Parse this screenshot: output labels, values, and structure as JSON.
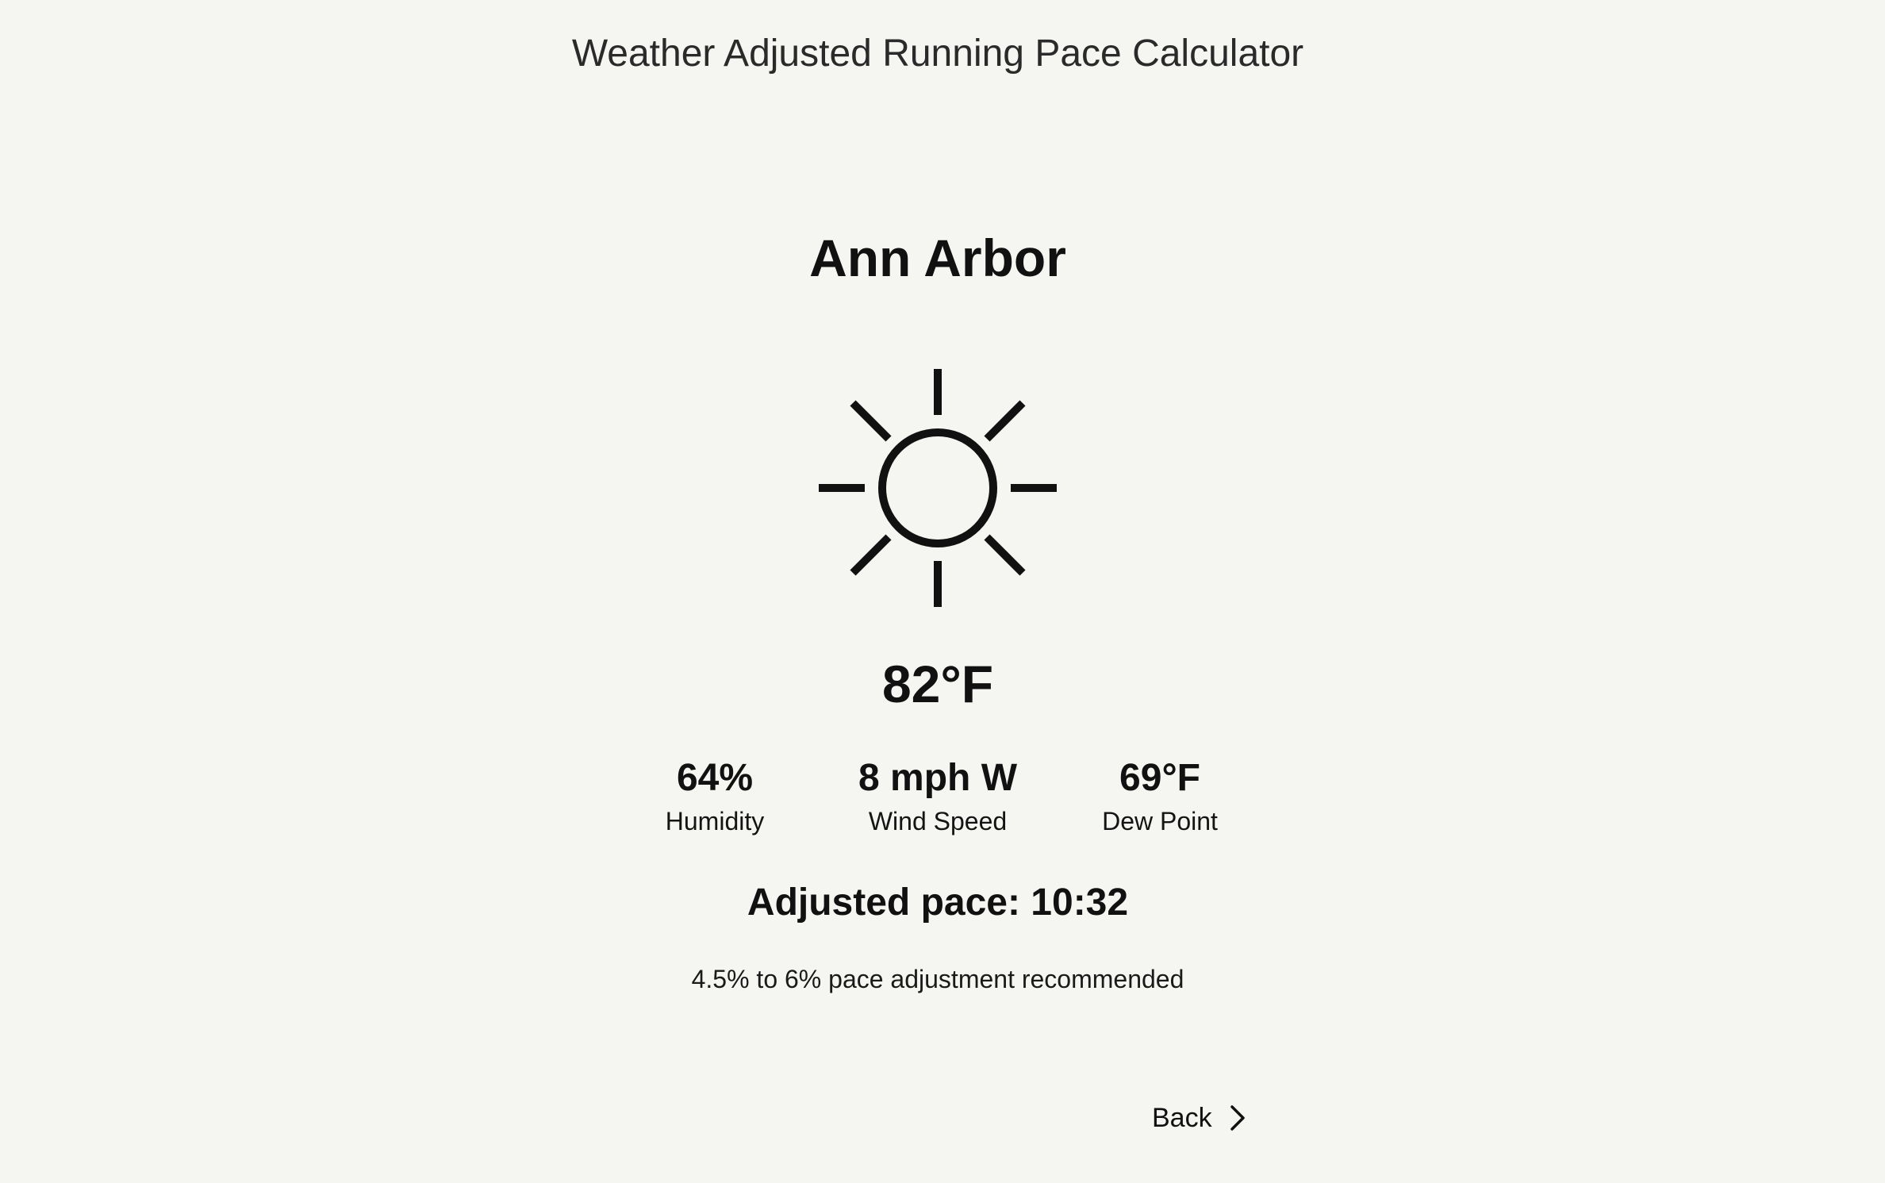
{
  "header": {
    "title": "Weather Adjusted Running Pace Calculator"
  },
  "location": {
    "city": "Ann Arbor"
  },
  "weather": {
    "condition_icon": "sun-icon",
    "temperature": "82°F",
    "stats": [
      {
        "value": "64%",
        "label": "Humidity"
      },
      {
        "value": "8 mph W",
        "label": "Wind Speed"
      },
      {
        "value": "69°F",
        "label": "Dew Point"
      }
    ]
  },
  "result": {
    "adjusted_pace": "Adjusted pace: 10:32",
    "recommendation": "4.5% to 6% pace adjustment recommended"
  },
  "navigation": {
    "back_label": "Back",
    "back_icon": "chevron-right-icon"
  }
}
